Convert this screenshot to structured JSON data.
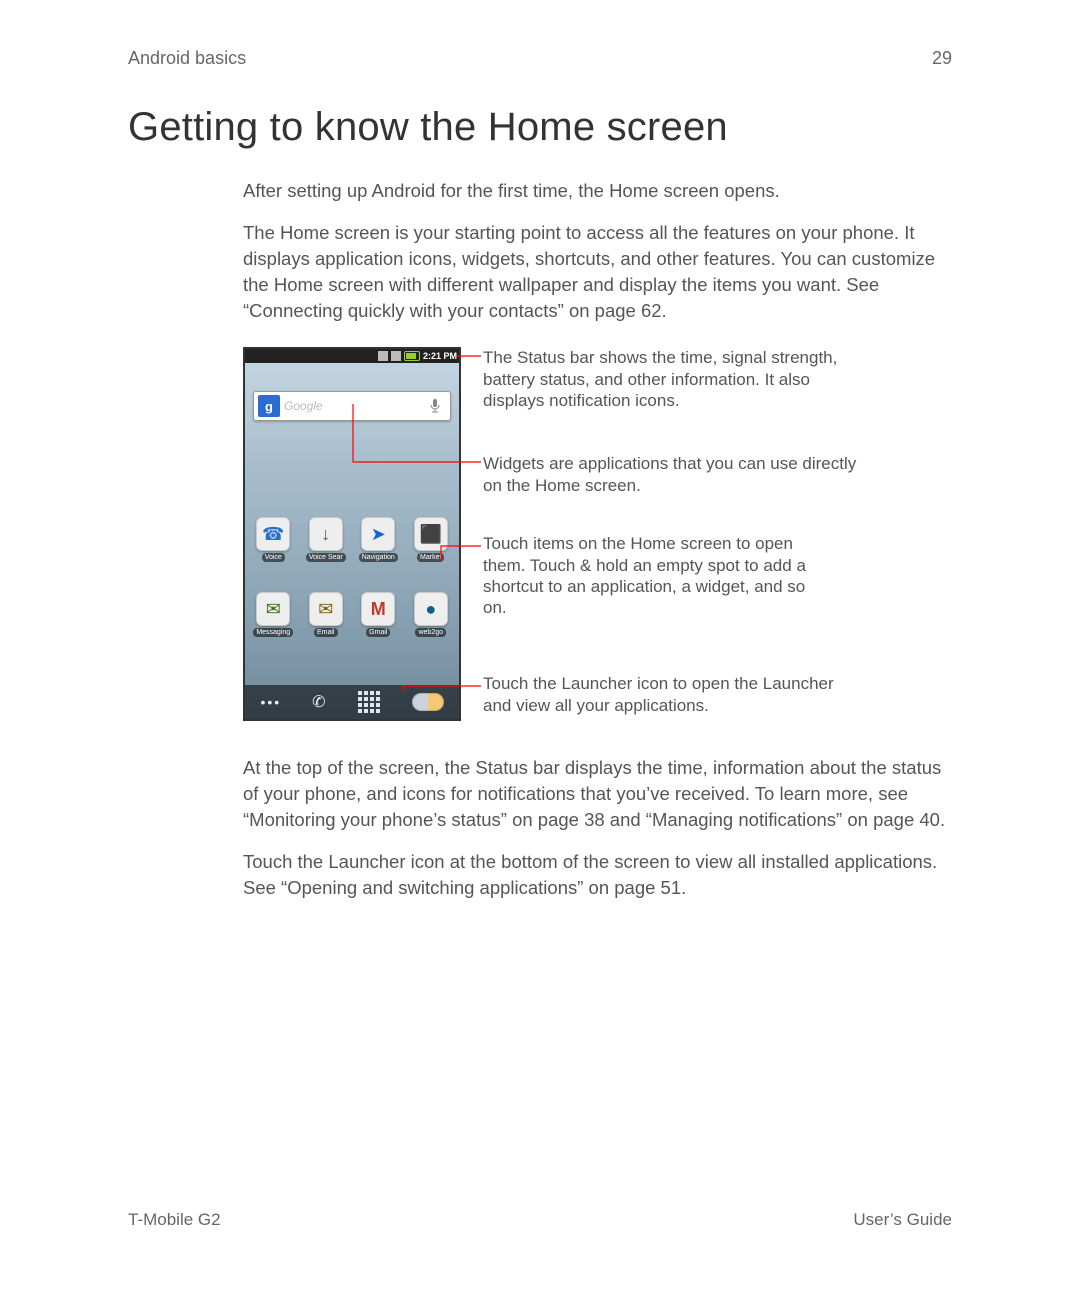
{
  "header": {
    "chapter": "Android basics",
    "page_number": "29"
  },
  "title": "Getting to know the Home screen",
  "paragraphs": {
    "p1": "After setting up Android for the first time, the Home screen opens.",
    "p2": "The Home screen is your starting point to access all the features on your phone. It displays application icons, widgets, shortcuts, and other features. You can customize the Home screen with different wallpaper and display the items you want. See “Connecting quickly with your contacts” on page 62.",
    "p3": "At the top of the screen, the Status bar displays the time, information about the status of your phone, and icons for notifications that you’ve received. To learn more, see “Monitoring your phone’s status” on page 38 and “Managing notifications” on page 40.",
    "p4": "Touch the Launcher icon at the bottom of the screen to view all installed applications. See “Opening and switching applications” on page 51."
  },
  "phone": {
    "status_time": "2:21 PM",
    "search_placeholder": "Google",
    "g_logo": "g",
    "apps_row1": [
      {
        "label": "Voice",
        "glyph": "☎",
        "css": "ic-voice"
      },
      {
        "label": "Voice Sear",
        "glyph": " ↓ ",
        "css": "ic-vsearch"
      },
      {
        "label": "Navigation",
        "glyph": "➤",
        "css": "ic-nav"
      },
      {
        "label": "Market",
        "glyph": "⬛",
        "css": "ic-market"
      }
    ],
    "apps_row2": [
      {
        "label": "Messaging",
        "glyph": "✉",
        "css": "ic-msg"
      },
      {
        "label": "Email",
        "glyph": "✉",
        "css": "ic-email"
      },
      {
        "label": "Gmail",
        "glyph": "M",
        "css": "ic-gmail"
      },
      {
        "label": "web2go",
        "glyph": "●",
        "css": "ic-web2go"
      }
    ],
    "quickbar_dots": "•••",
    "quickbar_phone": "✆"
  },
  "callouts": {
    "status_bar": "The Status bar shows the time, signal strength, battery status, and other information. It also displays notification icons.",
    "widgets": "Widgets are applications that you can use directly on the Home screen.",
    "icons": "Touch items on the Home screen to open them. Touch & hold an empty spot to add a shortcut to an application, a widget, and so on.",
    "launcher": "Touch the Launcher icon to open the Launcher and view all your applications."
  },
  "footer": {
    "product": "T-Mobile G2",
    "doc": "User’s Guide"
  }
}
